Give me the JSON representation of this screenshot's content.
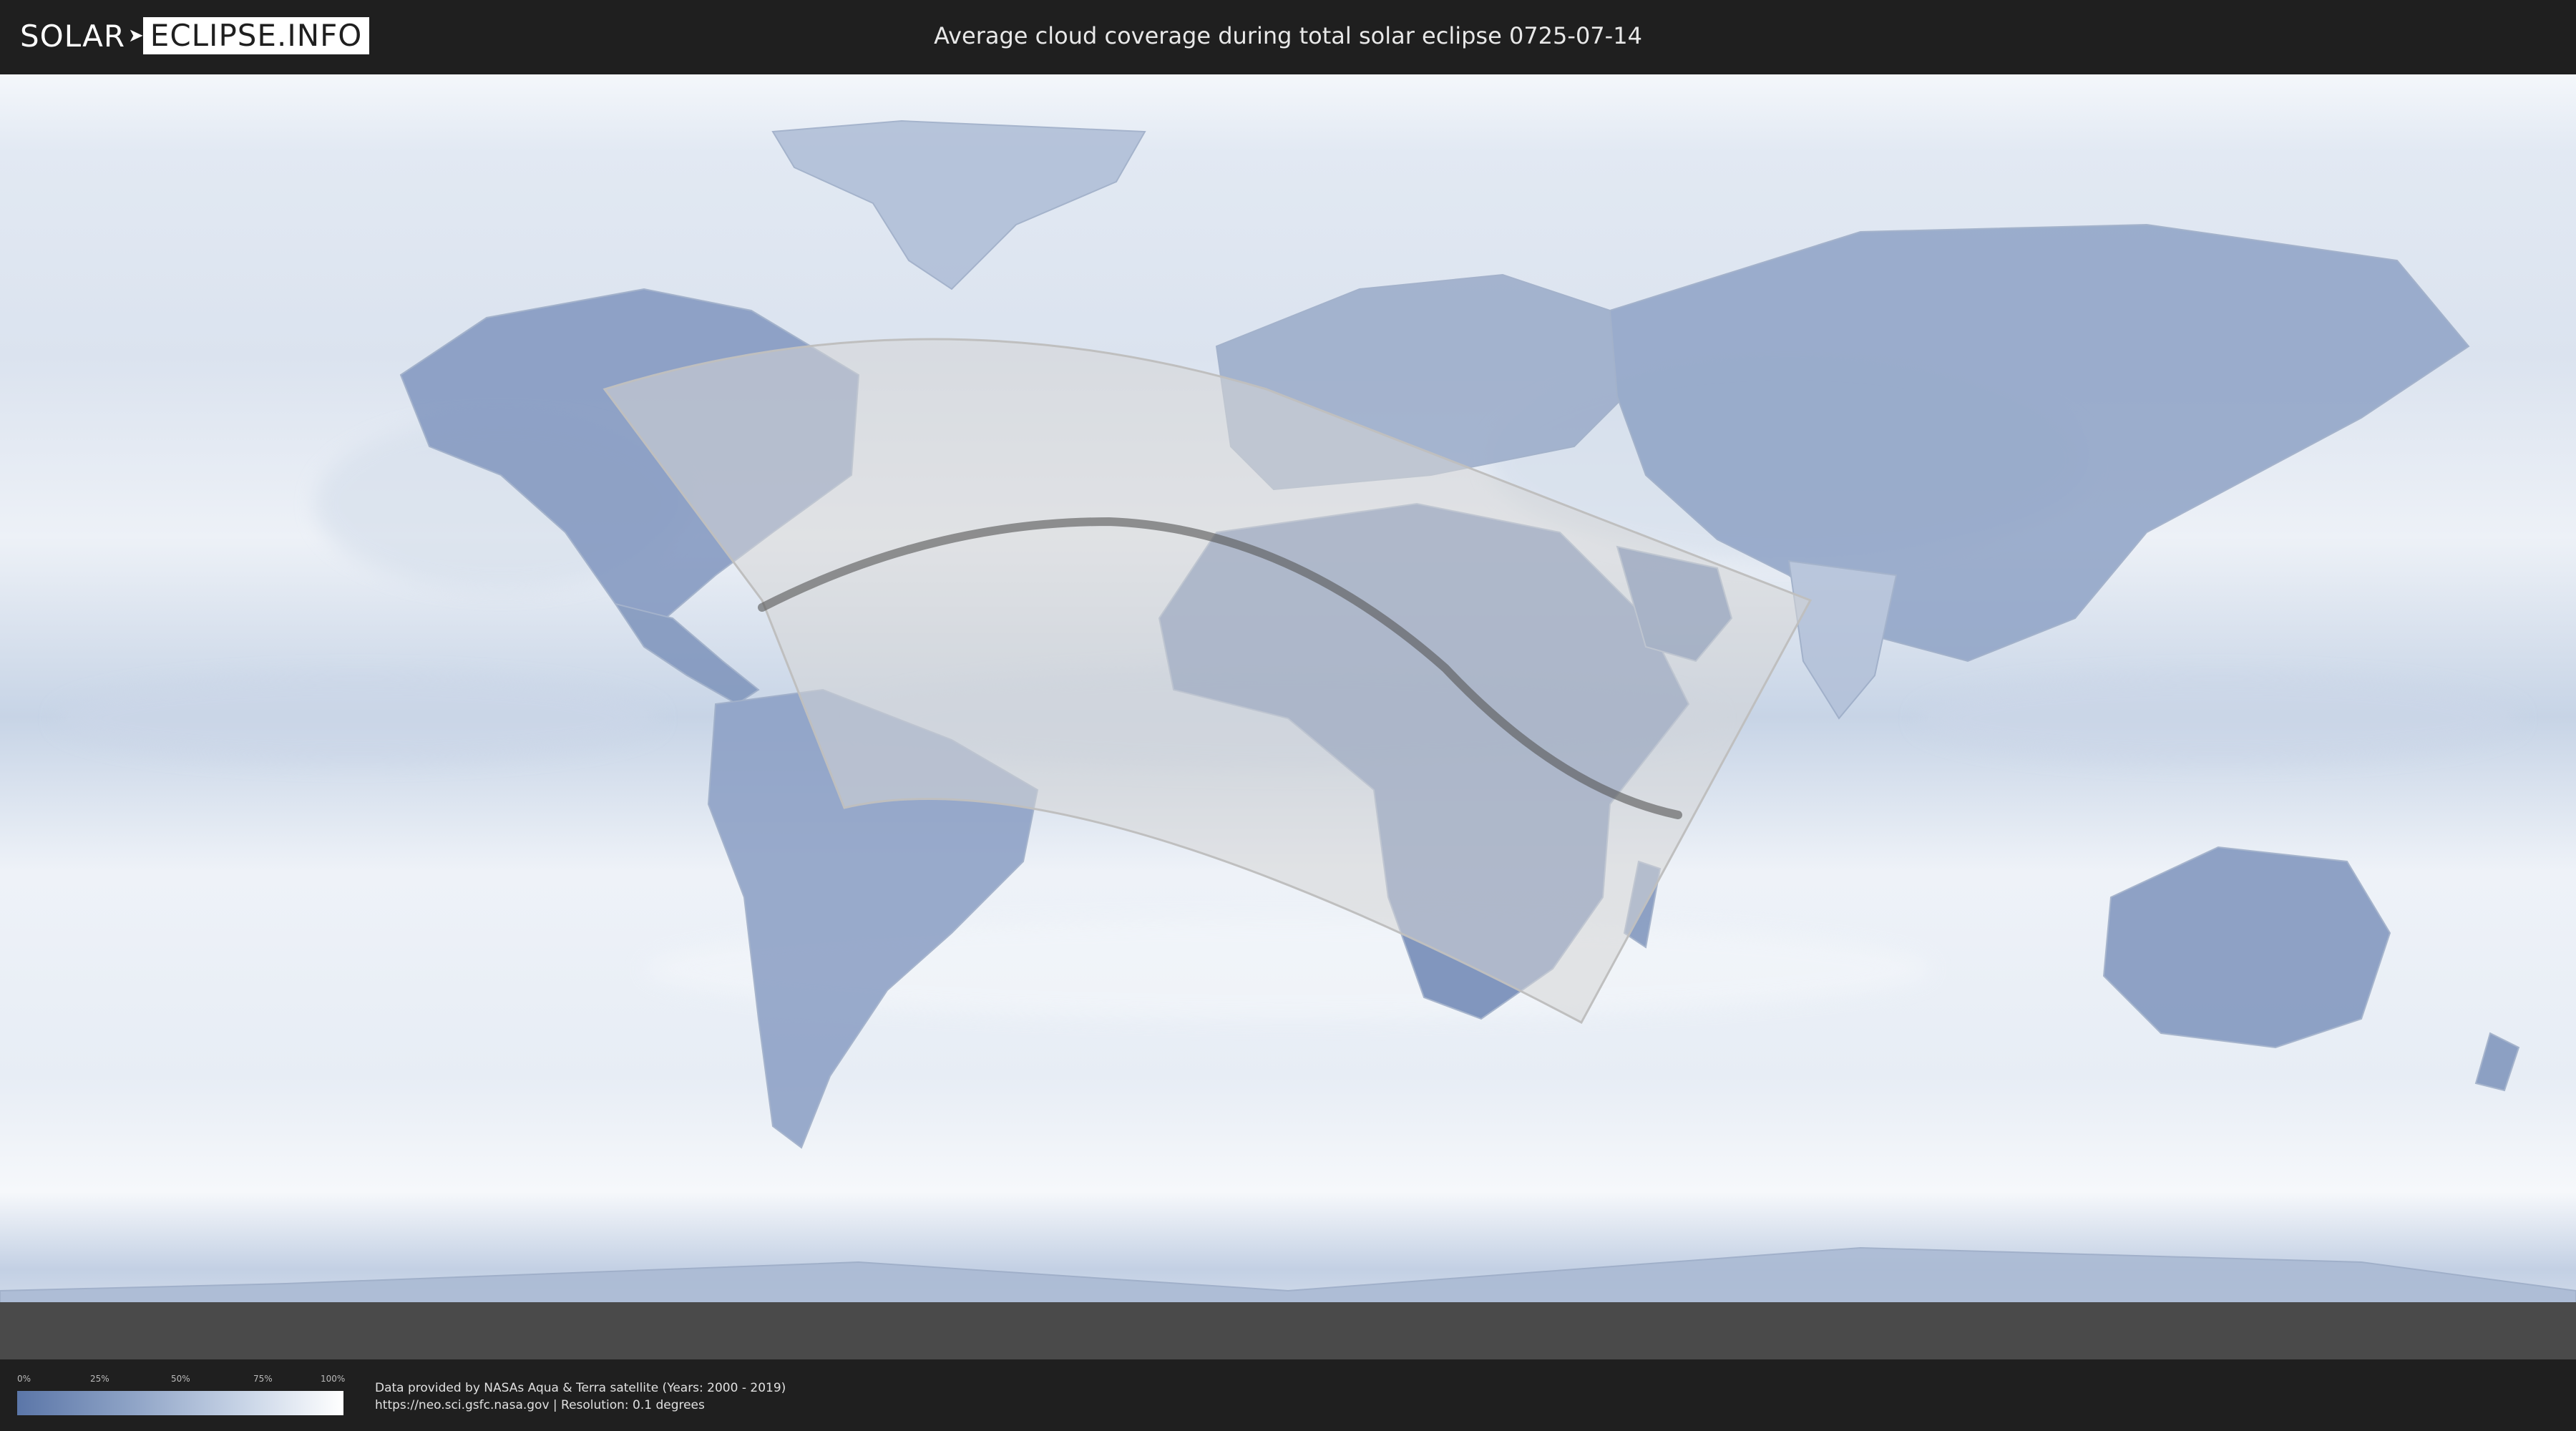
{
  "header": {
    "logo_left": "SOLAR",
    "logo_right": "ECLIPSE.INFO",
    "title": "Average cloud coverage during total solar eclipse 0725-07-14"
  },
  "legend": {
    "ticks": [
      "0%",
      "25%",
      "50%",
      "75%",
      "100%"
    ],
    "colors": {
      "low": "#5b76a8",
      "high": "#ffffff"
    }
  },
  "footer": {
    "source_line": "Data provided by NASAs Aqua & Terra satellite (Years: 2000 - 2019)",
    "url_line": "https://neo.sci.gsfc.nasa.gov | Resolution: 0.1 degrees"
  },
  "map": {
    "colors": {
      "clear_sky": "#5b76a8",
      "cloudy": "#ffffff",
      "eclipse_zone": "#d6d6d6",
      "totality_path": "#555555"
    }
  }
}
